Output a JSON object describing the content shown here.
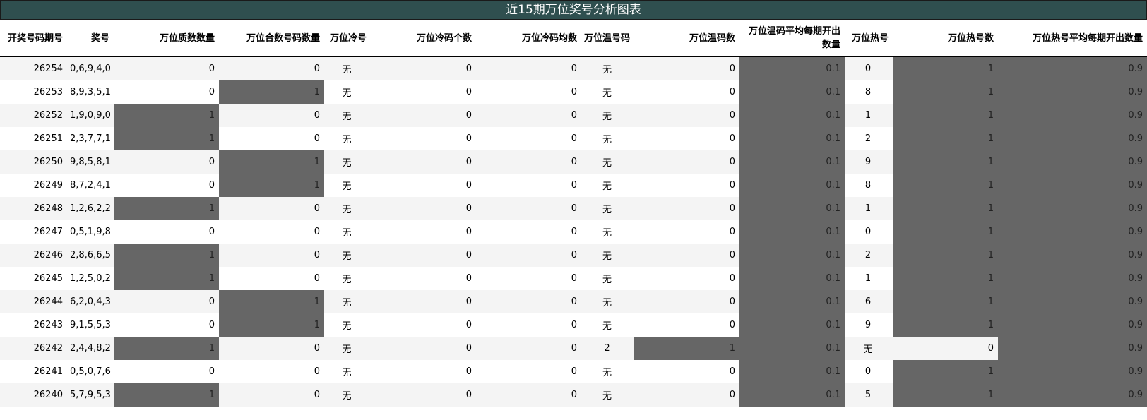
{
  "title": "近15期万位奖号分析图表",
  "colors": {
    "title_bg": "#2f4f4f",
    "highlight": "#666666",
    "stripe": "#f4f4f4"
  },
  "columns": [
    "开奖号码期号",
    "奖号",
    "万位质数数量",
    "万位合数号码数量",
    "万位冷号",
    "万位冷码个数",
    "万位冷码均数",
    "万位温号码",
    "万位温码数",
    "万位温码平均每期开出数量",
    "万位热号",
    "万位热号数",
    "万位热号平均每期开出数量"
  ],
  "rows": [
    [
      "26254",
      "0,6,9,4,0",
      "0",
      "0",
      "无",
      "0",
      "0",
      "无",
      "0",
      "0.1",
      "0",
      "1",
      "0.9"
    ],
    [
      "26253",
      "8,9,3,5,1",
      "0",
      "1",
      "无",
      "0",
      "0",
      "无",
      "0",
      "0.1",
      "8",
      "1",
      "0.9"
    ],
    [
      "26252",
      "1,9,0,9,0",
      "1",
      "0",
      "无",
      "0",
      "0",
      "无",
      "0",
      "0.1",
      "1",
      "1",
      "0.9"
    ],
    [
      "26251",
      "2,3,7,7,1",
      "1",
      "0",
      "无",
      "0",
      "0",
      "无",
      "0",
      "0.1",
      "2",
      "1",
      "0.9"
    ],
    [
      "26250",
      "9,8,5,8,1",
      "0",
      "1",
      "无",
      "0",
      "0",
      "无",
      "0",
      "0.1",
      "9",
      "1",
      "0.9"
    ],
    [
      "26249",
      "8,7,2,4,1",
      "0",
      "1",
      "无",
      "0",
      "0",
      "无",
      "0",
      "0.1",
      "8",
      "1",
      "0.9"
    ],
    [
      "26248",
      "1,2,6,2,2",
      "1",
      "0",
      "无",
      "0",
      "0",
      "无",
      "0",
      "0.1",
      "1",
      "1",
      "0.9"
    ],
    [
      "26247",
      "0,5,1,9,8",
      "0",
      "0",
      "无",
      "0",
      "0",
      "无",
      "0",
      "0.1",
      "0",
      "1",
      "0.9"
    ],
    [
      "26246",
      "2,8,6,6,5",
      "1",
      "0",
      "无",
      "0",
      "0",
      "无",
      "0",
      "0.1",
      "2",
      "1",
      "0.9"
    ],
    [
      "26245",
      "1,2,5,0,2",
      "1",
      "0",
      "无",
      "0",
      "0",
      "无",
      "0",
      "0.1",
      "1",
      "1",
      "0.9"
    ],
    [
      "26244",
      "6,2,0,4,3",
      "0",
      "1",
      "无",
      "0",
      "0",
      "无",
      "0",
      "0.1",
      "6",
      "1",
      "0.9"
    ],
    [
      "26243",
      "9,1,5,5,3",
      "0",
      "1",
      "无",
      "0",
      "0",
      "无",
      "0",
      "0.1",
      "9",
      "1",
      "0.9"
    ],
    [
      "26242",
      "2,4,4,8,2",
      "1",
      "0",
      "无",
      "0",
      "0",
      "2",
      "1",
      "0.1",
      "无",
      "0",
      "0.9"
    ],
    [
      "26241",
      "0,5,0,7,6",
      "0",
      "0",
      "无",
      "0",
      "0",
      "无",
      "0",
      "0.1",
      "0",
      "1",
      "0.9"
    ],
    [
      "26240",
      "5,7,9,5,3",
      "1",
      "0",
      "无",
      "0",
      "0",
      "无",
      "0",
      "0.1",
      "5",
      "1",
      "0.9"
    ]
  ]
}
